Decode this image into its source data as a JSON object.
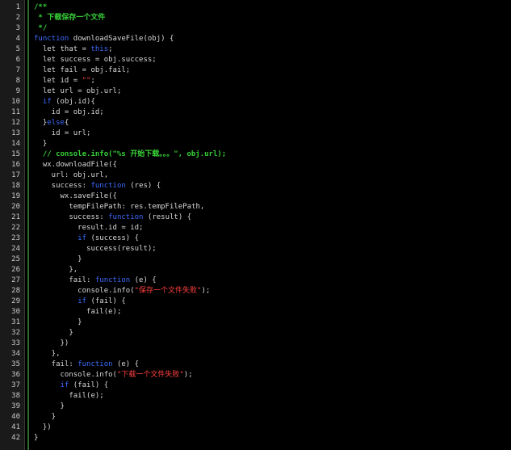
{
  "lines": [
    {
      "n": "1",
      "parts": [
        {
          "t": "/**",
          "c": "cm"
        }
      ]
    },
    {
      "n": "2",
      "parts": [
        {
          "t": " * 下载保存一个文件",
          "c": "cm"
        }
      ]
    },
    {
      "n": "3",
      "parts": [
        {
          "t": " */",
          "c": "cm"
        }
      ]
    },
    {
      "n": "4",
      "parts": [
        {
          "t": "function",
          "c": "kw"
        },
        {
          "t": " downloadSaveFile(obj) {",
          "c": ""
        }
      ]
    },
    {
      "n": "5",
      "parts": [
        {
          "t": "  let that = ",
          "c": ""
        },
        {
          "t": "this",
          "c": "kw"
        },
        {
          "t": ";",
          "c": ""
        }
      ]
    },
    {
      "n": "6",
      "parts": [
        {
          "t": "  let success = obj.success;",
          "c": ""
        }
      ]
    },
    {
      "n": "7",
      "parts": [
        {
          "t": "  let fail = obj.fail;",
          "c": ""
        }
      ]
    },
    {
      "n": "8",
      "parts": [
        {
          "t": "  let id = ",
          "c": ""
        },
        {
          "t": "\"\"",
          "c": "st"
        },
        {
          "t": ";",
          "c": ""
        }
      ]
    },
    {
      "n": "9",
      "parts": [
        {
          "t": "  let url = obj.url;",
          "c": ""
        }
      ]
    },
    {
      "n": "10",
      "parts": [
        {
          "t": "  ",
          "c": ""
        },
        {
          "t": "if",
          "c": "kw"
        },
        {
          "t": " (obj.id){",
          "c": ""
        }
      ]
    },
    {
      "n": "11",
      "parts": [
        {
          "t": "    id = obj.id;",
          "c": ""
        }
      ]
    },
    {
      "n": "12",
      "parts": [
        {
          "t": "  }",
          "c": ""
        },
        {
          "t": "else",
          "c": "kw"
        },
        {
          "t": "{",
          "c": ""
        }
      ]
    },
    {
      "n": "13",
      "parts": [
        {
          "t": "    id = url;",
          "c": ""
        }
      ]
    },
    {
      "n": "14",
      "parts": [
        {
          "t": "  }",
          "c": ""
        }
      ]
    },
    {
      "n": "15",
      "parts": [
        {
          "t": "  // console.info(\"%s 开始下载。。。\", obj.url);",
          "c": "cm"
        }
      ]
    },
    {
      "n": "16",
      "parts": [
        {
          "t": "  wx.downloadFile({",
          "c": ""
        }
      ]
    },
    {
      "n": "17",
      "parts": [
        {
          "t": "    url: obj.url,",
          "c": ""
        }
      ]
    },
    {
      "n": "18",
      "parts": [
        {
          "t": "    success: ",
          "c": ""
        },
        {
          "t": "function",
          "c": "kw"
        },
        {
          "t": " (res) {",
          "c": ""
        }
      ]
    },
    {
      "n": "19",
      "parts": [
        {
          "t": "      wx.saveFile({",
          "c": ""
        }
      ]
    },
    {
      "n": "20",
      "parts": [
        {
          "t": "        tempFilePath: res.tempFilePath,",
          "c": ""
        }
      ]
    },
    {
      "n": "21",
      "parts": [
        {
          "t": "        success: ",
          "c": ""
        },
        {
          "t": "function",
          "c": "kw"
        },
        {
          "t": " (result) {",
          "c": ""
        }
      ]
    },
    {
      "n": "22",
      "parts": [
        {
          "t": "          result.id = id;",
          "c": ""
        }
      ]
    },
    {
      "n": "23",
      "parts": [
        {
          "t": "          ",
          "c": ""
        },
        {
          "t": "if",
          "c": "kw"
        },
        {
          "t": " (success) {",
          "c": ""
        }
      ]
    },
    {
      "n": "24",
      "parts": [
        {
          "t": "            success(result);",
          "c": ""
        }
      ]
    },
    {
      "n": "25",
      "parts": [
        {
          "t": "          }",
          "c": ""
        }
      ]
    },
    {
      "n": "26",
      "parts": [
        {
          "t": "        },",
          "c": ""
        }
      ]
    },
    {
      "n": "27",
      "parts": [
        {
          "t": "        fail: ",
          "c": ""
        },
        {
          "t": "function",
          "c": "kw"
        },
        {
          "t": " (e) {",
          "c": ""
        }
      ]
    },
    {
      "n": "28",
      "parts": [
        {
          "t": "          console.info(",
          "c": ""
        },
        {
          "t": "\"保存一个文件失败\"",
          "c": "st"
        },
        {
          "t": ");",
          "c": ""
        }
      ]
    },
    {
      "n": "29",
      "parts": [
        {
          "t": "          ",
          "c": ""
        },
        {
          "t": "if",
          "c": "kw"
        },
        {
          "t": " (fail) {",
          "c": ""
        }
      ]
    },
    {
      "n": "30",
      "parts": [
        {
          "t": "            fail(e);",
          "c": ""
        }
      ]
    },
    {
      "n": "31",
      "parts": [
        {
          "t": "          }",
          "c": ""
        }
      ]
    },
    {
      "n": "32",
      "parts": [
        {
          "t": "        }",
          "c": ""
        }
      ]
    },
    {
      "n": "33",
      "parts": [
        {
          "t": "      })",
          "c": ""
        }
      ]
    },
    {
      "n": "34",
      "parts": [
        {
          "t": "    },",
          "c": ""
        }
      ]
    },
    {
      "n": "35",
      "parts": [
        {
          "t": "    fail: ",
          "c": ""
        },
        {
          "t": "function",
          "c": "kw"
        },
        {
          "t": " (e) {",
          "c": ""
        }
      ]
    },
    {
      "n": "36",
      "parts": [
        {
          "t": "      console.info(",
          "c": ""
        },
        {
          "t": "\"下载一个文件失败\"",
          "c": "st"
        },
        {
          "t": ");",
          "c": ""
        }
      ]
    },
    {
      "n": "37",
      "parts": [
        {
          "t": "      ",
          "c": ""
        },
        {
          "t": "if",
          "c": "kw"
        },
        {
          "t": " (fail) {",
          "c": ""
        }
      ]
    },
    {
      "n": "38",
      "parts": [
        {
          "t": "        fail(e);",
          "c": ""
        }
      ]
    },
    {
      "n": "39",
      "parts": [
        {
          "t": "      }",
          "c": ""
        }
      ]
    },
    {
      "n": "40",
      "parts": [
        {
          "t": "    }",
          "c": ""
        }
      ]
    },
    {
      "n": "41",
      "parts": [
        {
          "t": "  })",
          "c": ""
        }
      ]
    },
    {
      "n": "42",
      "parts": [
        {
          "t": "}",
          "c": ""
        }
      ]
    }
  ],
  "colors": {
    "background": "#000000",
    "gutter": "#1a1a1a",
    "keyword": "#3d6cff",
    "comment": "#38d038",
    "string": "#ff4040",
    "text": "#d8d8d8",
    "line_number": "#c8c8c8"
  }
}
